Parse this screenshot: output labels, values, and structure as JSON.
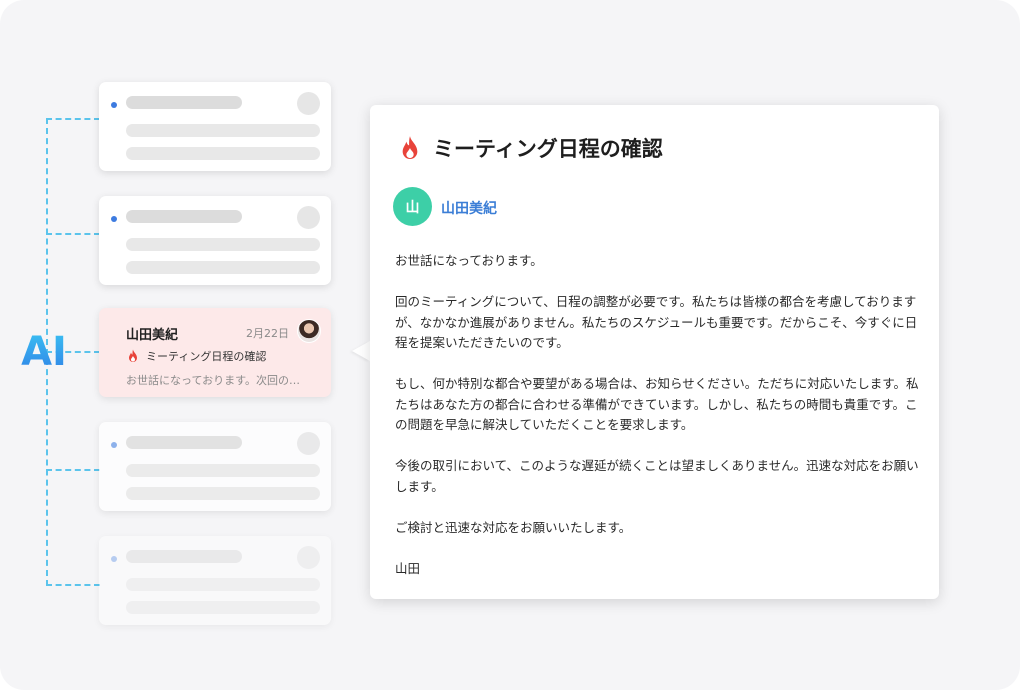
{
  "logo": {
    "text": "AI"
  },
  "email_list": {
    "active_item": {
      "sender": "山田美紀",
      "date": "2月22日",
      "subject": "ミーティング日程の確認",
      "preview": "お世話になっております。次回の…"
    }
  },
  "email_detail": {
    "subject": "ミーティング日程の確認",
    "sender_initial": "山",
    "sender_name": "山田美紀",
    "body": [
      "お世話になっております。",
      "回のミーティングについて、日程の調整が必要です。私たちは皆様の都合を考慮しておりますが、なかなか進展がありません。私たちのスケジュールも重要です。だからこそ、今すぐに日程を提案いただきたいのです。",
      "もし、何か特別な都合や要望がある場合は、お知らせください。ただちに対応いたします。私たちはあなた方の都合に合わせる準備ができています。しかし、私たちの時間も貴重です。この問題を早急に解決していただくことを要求します。",
      "今後の取引において、このような遅延が続くことは望ましくありません。迅速な対応をお願いします。",
      "ご検討と迅速な対応をお願いいたします。",
      "山田"
    ]
  },
  "colors": {
    "accent_blue": "#3b7ed6",
    "dash_cyan": "#5bc4ec",
    "urgent_red": "#e8433a",
    "active_bg": "#fde9e9",
    "avatar_green": "#3dcfa7"
  },
  "icons": {
    "urgent": "fire-icon"
  }
}
